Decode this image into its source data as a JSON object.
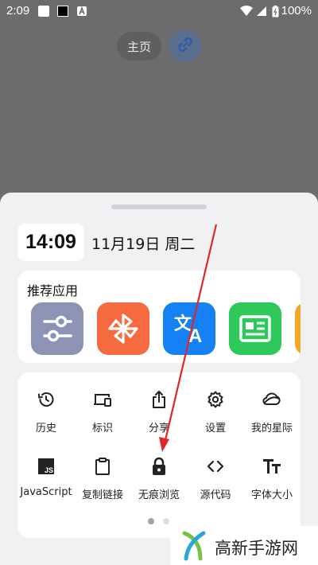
{
  "status_bar": {
    "time": "2:09",
    "battery": "100%"
  },
  "top": {
    "home_label": "主页"
  },
  "widget": {
    "time": "14:09",
    "date": "11月19日 周二"
  },
  "recommended": {
    "title": "推荐应用",
    "apps": [
      {
        "icon": "sliders-icon",
        "color": "#8d93b4"
      },
      {
        "icon": "pinwheel-icon",
        "color": "#f66a3f"
      },
      {
        "icon": "translate-icon",
        "color": "#1680f5"
      },
      {
        "icon": "news-icon",
        "color": "#2ec95a"
      },
      {
        "icon": "app-icon",
        "color": "#f5a623"
      }
    ]
  },
  "tools": {
    "row1": [
      {
        "label": "历史",
        "icon": "history-icon"
      },
      {
        "label": "标识",
        "icon": "devices-icon"
      },
      {
        "label": "分享",
        "icon": "share-icon"
      },
      {
        "label": "设置",
        "icon": "gear-icon"
      },
      {
        "label": "我的星际",
        "icon": "cloud-icon"
      }
    ],
    "row2": [
      {
        "label": "JavaScript",
        "icon": "javascript-icon"
      },
      {
        "label": "复制链接",
        "icon": "clipboard-icon"
      },
      {
        "label": "无痕浏览",
        "icon": "lock-icon"
      },
      {
        "label": "源代码",
        "icon": "code-icon"
      },
      {
        "label": "字体大小",
        "icon": "font-size-icon"
      }
    ]
  },
  "pager": {
    "active_page": 1,
    "pages": 2
  },
  "watermark": {
    "text": "高新手游网"
  },
  "colors": {
    "annotation_arrow": "#e0262a",
    "overlay": "#6c6c6e",
    "sheet": "#f1f1f4"
  }
}
